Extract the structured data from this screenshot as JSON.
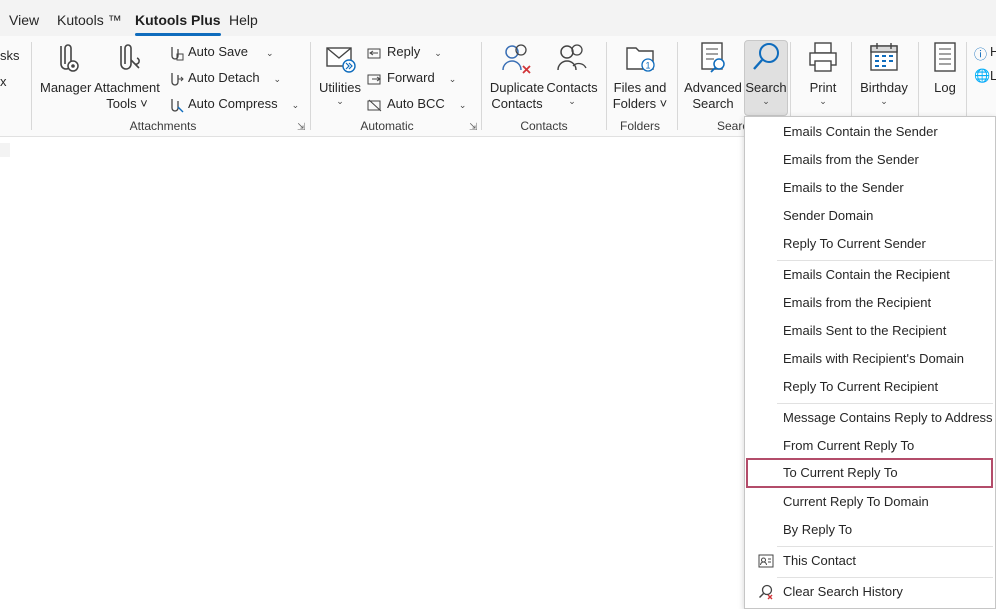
{
  "menubar": {
    "tabs": [
      {
        "label": "View"
      },
      {
        "label": "Kutools ™"
      },
      {
        "label": "Kutools Plus"
      },
      {
        "label": "Help"
      }
    ]
  },
  "ribbon": {
    "left_cut": {
      "line1": "sks",
      "line2": "x"
    },
    "attachments": {
      "group_label": "Attachments",
      "manager": "Manager",
      "attachment_tools": "Attachment",
      "attachment_tools_line2": "Tools ˅",
      "auto_save": "Auto Save",
      "auto_detach": "Auto Detach",
      "auto_compress": "Auto Compress"
    },
    "automatic": {
      "group_label": "Automatic",
      "utilities": "Utilities",
      "reply": "Reply",
      "forward": "Forward",
      "auto_bcc": "Auto BCC"
    },
    "contacts": {
      "group_label": "Contacts",
      "duplicate_line1": "Duplicate",
      "duplicate_line2": "Contacts",
      "contacts": "Contacts"
    },
    "folders": {
      "group_label": "Folders",
      "files_line1": "Files and",
      "files_line2": "Folders ˅"
    },
    "search": {
      "group_label": "Searc",
      "advanced_line1": "Advanced",
      "advanced_line2": "Search",
      "search": "Search"
    },
    "print": "Print",
    "birthday": "Birthday",
    "log": "Log",
    "right_cut": {
      "line1": "H",
      "line2": "L"
    }
  },
  "search_menu": {
    "sender": [
      "Emails Contain the Sender",
      "Emails from the Sender",
      "Emails to the Sender",
      "Sender Domain",
      "Reply To Current Sender"
    ],
    "recipient": [
      "Emails Contain the Recipient",
      "Emails from the Recipient",
      "Emails Sent to the Recipient",
      "Emails with Recipient's Domain",
      "Reply To Current Recipient"
    ],
    "reply_to": [
      "Message Contains Reply to Address",
      "From Current Reply To",
      "To Current Reply To",
      "Current Reply To Domain",
      "By Reply To"
    ],
    "this_contact": "This Contact",
    "clear_history": "Clear Search History",
    "highlighted": "To Current Reply To"
  },
  "colors": {
    "accent": "#0f6cbd",
    "highlight_border": "#b34c6a"
  }
}
